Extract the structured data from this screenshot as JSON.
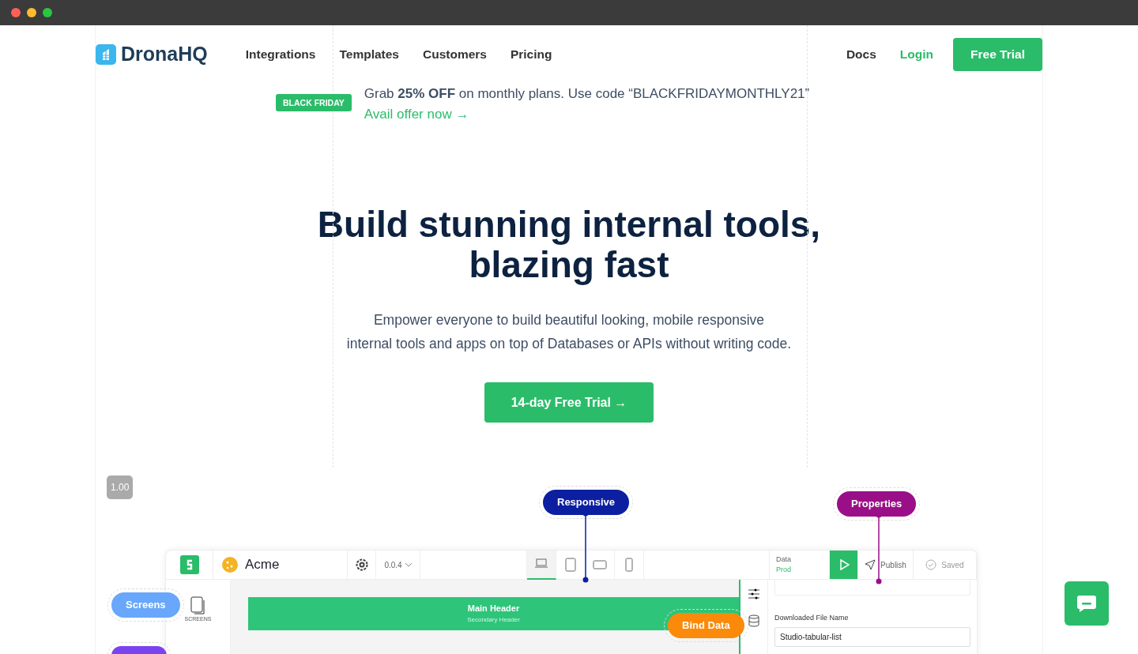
{
  "nav": {
    "brand": "DronaHQ",
    "links": [
      "Integrations",
      "Templates",
      "Customers",
      "Pricing"
    ],
    "docs": "Docs",
    "login": "Login",
    "trial": "Free Trial"
  },
  "promo": {
    "badge": "BLACK FRIDAY",
    "text": "Grab **25% OFF** on monthly plans. Use code “BLACKFRIDAYMONTHLY21”",
    "link": "Avail offer now →"
  },
  "hero": {
    "title_lines": [
      "Build stunning internal tools,",
      "blazing fast"
    ],
    "subtitle_lines": [
      "Empower everyone to build beautiful looking, mobile responsive",
      "internal tools and apps on top of Databases or APIs without writing code."
    ],
    "cta": "14-day Free Trial →"
  },
  "zoom_badge": "1.00",
  "callouts": [
    {
      "label": "Responsive",
      "color": "#0c1fa0",
      "kind": "top"
    },
    {
      "label": "Properties",
      "color": "#9a0f88",
      "kind": "top"
    },
    {
      "label": "Screens",
      "color": "#68a7fb",
      "kind": "side"
    },
    {
      "label": "Bind Data",
      "color": "#fb8a0a",
      "kind": "side"
    },
    {
      "color": "#7b43ee",
      "kind": "side"
    }
  ],
  "app": {
    "name": "Acme",
    "version": "0.0.4",
    "devices": [
      {
        "kind": "laptop",
        "selected": true
      },
      {
        "kind": "tablet",
        "selected": false
      },
      {
        "kind": "landscape",
        "selected": false
      },
      {
        "kind": "phone",
        "selected": false
      }
    ],
    "data_label": "Data",
    "data_value": "Prod",
    "publish": "Publish",
    "saved": "Saved",
    "sidebar_label": "SCREENS",
    "canvas_header": "Main Header",
    "canvas_subheader": "Secondary Header",
    "field_label": "Downloaded File Name",
    "field_value": "Studio-tabular-list"
  }
}
